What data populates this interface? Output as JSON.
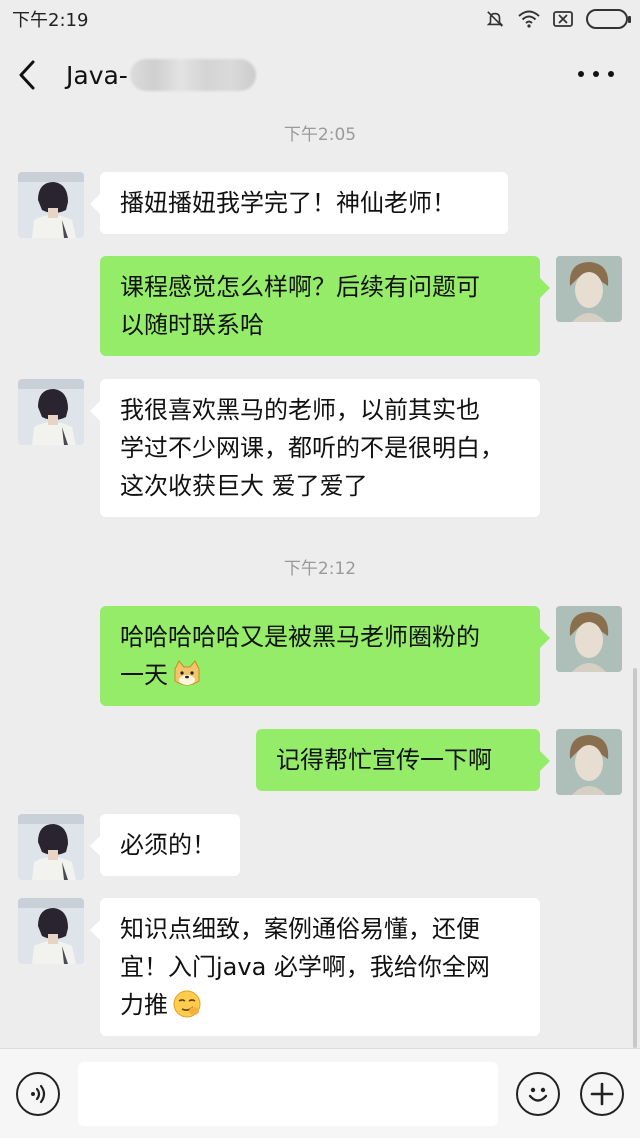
{
  "status_bar": {
    "time": "下午2:19"
  },
  "header": {
    "title": "Java-"
  },
  "colors": {
    "background": "#ededed",
    "bubble_self": "#95ec69",
    "bubble_other": "#ffffff",
    "timestamp": "#9a9a9a"
  },
  "chat": {
    "timestamps": [
      "下午2:05",
      "下午2:12"
    ],
    "messages": [
      {
        "from": "other",
        "text": "播妞播妞我学完了！神仙老师！"
      },
      {
        "from": "self",
        "text": "课程感觉怎么样啊？后续有问题可\n以随时联系哈"
      },
      {
        "from": "other",
        "text": "我很喜欢黑马的老师，以前其实也\n学过不少网课，都听的不是很明白，\n这次收获巨大 爱了爱了"
      },
      {
        "from": "self",
        "text": "哈哈哈哈哈又是被黑马老师圈粉的\n一天",
        "emoji": "doge-emoji"
      },
      {
        "from": "self",
        "text": "记得帮忙宣传一下啊"
      },
      {
        "from": "other",
        "text": "必须的！"
      },
      {
        "from": "other",
        "text": "知识点细致，案例通俗易懂，还便\n宜！入门java 必学啊，我给你全网\n力推",
        "emoji": "smirk-emoji"
      }
    ]
  },
  "input_bar": {
    "placeholder": "",
    "voice_icon": "voice-icon",
    "emoji_icon": "emoji-face-icon",
    "plus_icon": "plus-icon"
  }
}
